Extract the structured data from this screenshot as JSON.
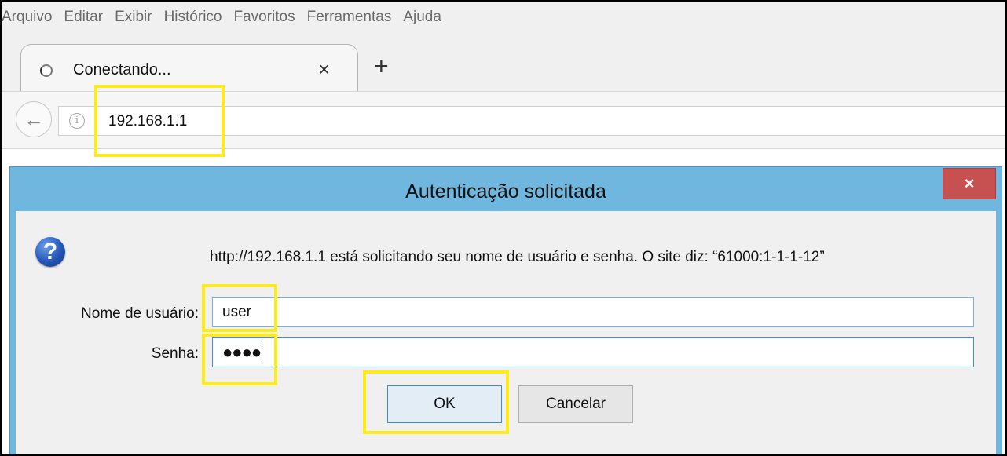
{
  "menu": [
    "Arquivo",
    "Editar",
    "Exibir",
    "Histórico",
    "Favoritos",
    "Ferramentas",
    "Ajuda"
  ],
  "tab": {
    "title": "Conectando...",
    "close": "×",
    "new_tab": "+"
  },
  "navbar": {
    "url": "192.168.1.1",
    "info": "i",
    "back": "←"
  },
  "dialog": {
    "title": "Autenticação solicitada",
    "close": "×",
    "message": "http://192.168.1.1 está solicitando seu nome de usuário e senha. O site diz: “61000:1-1-1-12”",
    "username_label": "Nome de usuário:",
    "username_value": "user",
    "password_label": "Senha:",
    "password_value": "●●●●",
    "ok_label": "OK",
    "cancel_label": "Cancelar",
    "question_glyph": "?"
  },
  "colors": {
    "highlight": "#ffeb1a",
    "dialog_frame": "#6fb7df",
    "close_button": "#c75050"
  }
}
